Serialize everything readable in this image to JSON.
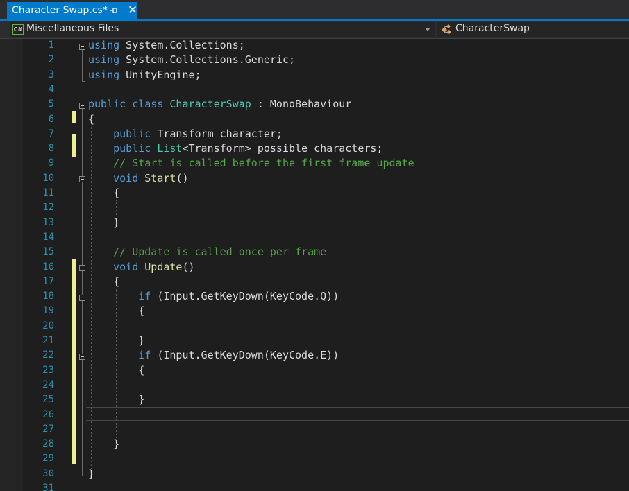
{
  "tab": {
    "title": "Character Swap.cs*"
  },
  "navbar": {
    "project_icon_text": "C#",
    "project": "Miscellaneous Files",
    "class_name": "CharacterSwap"
  },
  "editor": {
    "line_numbers": [
      "1",
      "2",
      "3",
      "4",
      "5",
      "6",
      "7",
      "8",
      "9",
      "10",
      "11",
      "12",
      "13",
      "14",
      "15",
      "16",
      "17",
      "18",
      "19",
      "20",
      "21",
      "22",
      "23",
      "24",
      "25",
      "26",
      "27",
      "28",
      "29",
      "30",
      "31"
    ],
    "lines": [
      [
        [
          "kw",
          "using"
        ],
        [
          "pl",
          " System.Collections;"
        ]
      ],
      [
        [
          "kw",
          "using"
        ],
        [
          "pl",
          " System.Collections.Generic;"
        ]
      ],
      [
        [
          "kw",
          "using"
        ],
        [
          "pl",
          " UnityEngine;"
        ]
      ],
      [],
      [
        [
          "kw",
          "public"
        ],
        [
          "pl",
          " "
        ],
        [
          "kw",
          "class"
        ],
        [
          "pl",
          " "
        ],
        [
          "ty",
          "CharacterSwap"
        ],
        [
          "pl",
          " : MonoBehaviour"
        ]
      ],
      [
        [
          "pl",
          "{"
        ]
      ],
      [
        [
          "pl",
          "    "
        ],
        [
          "kw",
          "public"
        ],
        [
          "pl",
          " Transform character;"
        ]
      ],
      [
        [
          "pl",
          "    "
        ],
        [
          "kw",
          "public"
        ],
        [
          "pl",
          " "
        ],
        [
          "ty",
          "List"
        ],
        [
          "pl",
          "<Transform> possible characters;"
        ]
      ],
      [
        [
          "pl",
          "    "
        ],
        [
          "cm",
          "// Start is called before the first frame update"
        ]
      ],
      [
        [
          "pl",
          "    "
        ],
        [
          "kw",
          "void"
        ],
        [
          "pl",
          " "
        ],
        [
          "mt",
          "Start"
        ],
        [
          "pl",
          "()"
        ]
      ],
      [
        [
          "pl",
          "    {"
        ]
      ],
      [],
      [
        [
          "pl",
          "    }"
        ]
      ],
      [],
      [
        [
          "pl",
          "    "
        ],
        [
          "cm",
          "// Update is called once per frame"
        ]
      ],
      [
        [
          "pl",
          "    "
        ],
        [
          "kw",
          "void"
        ],
        [
          "pl",
          " "
        ],
        [
          "mt",
          "Update"
        ],
        [
          "pl",
          "()"
        ]
      ],
      [
        [
          "pl",
          "    {"
        ]
      ],
      [
        [
          "pl",
          "        "
        ],
        [
          "kw",
          "if"
        ],
        [
          "pl",
          " (Input.GetKeyDown(KeyCode.Q))"
        ]
      ],
      [
        [
          "pl",
          "        {"
        ]
      ],
      [],
      [
        [
          "pl",
          "        }"
        ]
      ],
      [
        [
          "pl",
          "        "
        ],
        [
          "kw",
          "if"
        ],
        [
          "pl",
          " (Input.GetKeyDown(KeyCode.E))"
        ]
      ],
      [
        [
          "pl",
          "        {"
        ]
      ],
      [],
      [
        [
          "pl",
          "        }"
        ]
      ],
      [],
      [],
      [
        [
          "pl",
          "    }"
        ]
      ],
      [],
      [
        [
          "pl",
          "}"
        ]
      ],
      []
    ],
    "colors": {
      "keyword": "#569cd6",
      "type": "#4ec9b0",
      "comment": "#57a64a",
      "method": "#dcdcaa",
      "line_number": "#2b91af",
      "change_bar": "#efef91",
      "accent": "#007acc"
    }
  }
}
